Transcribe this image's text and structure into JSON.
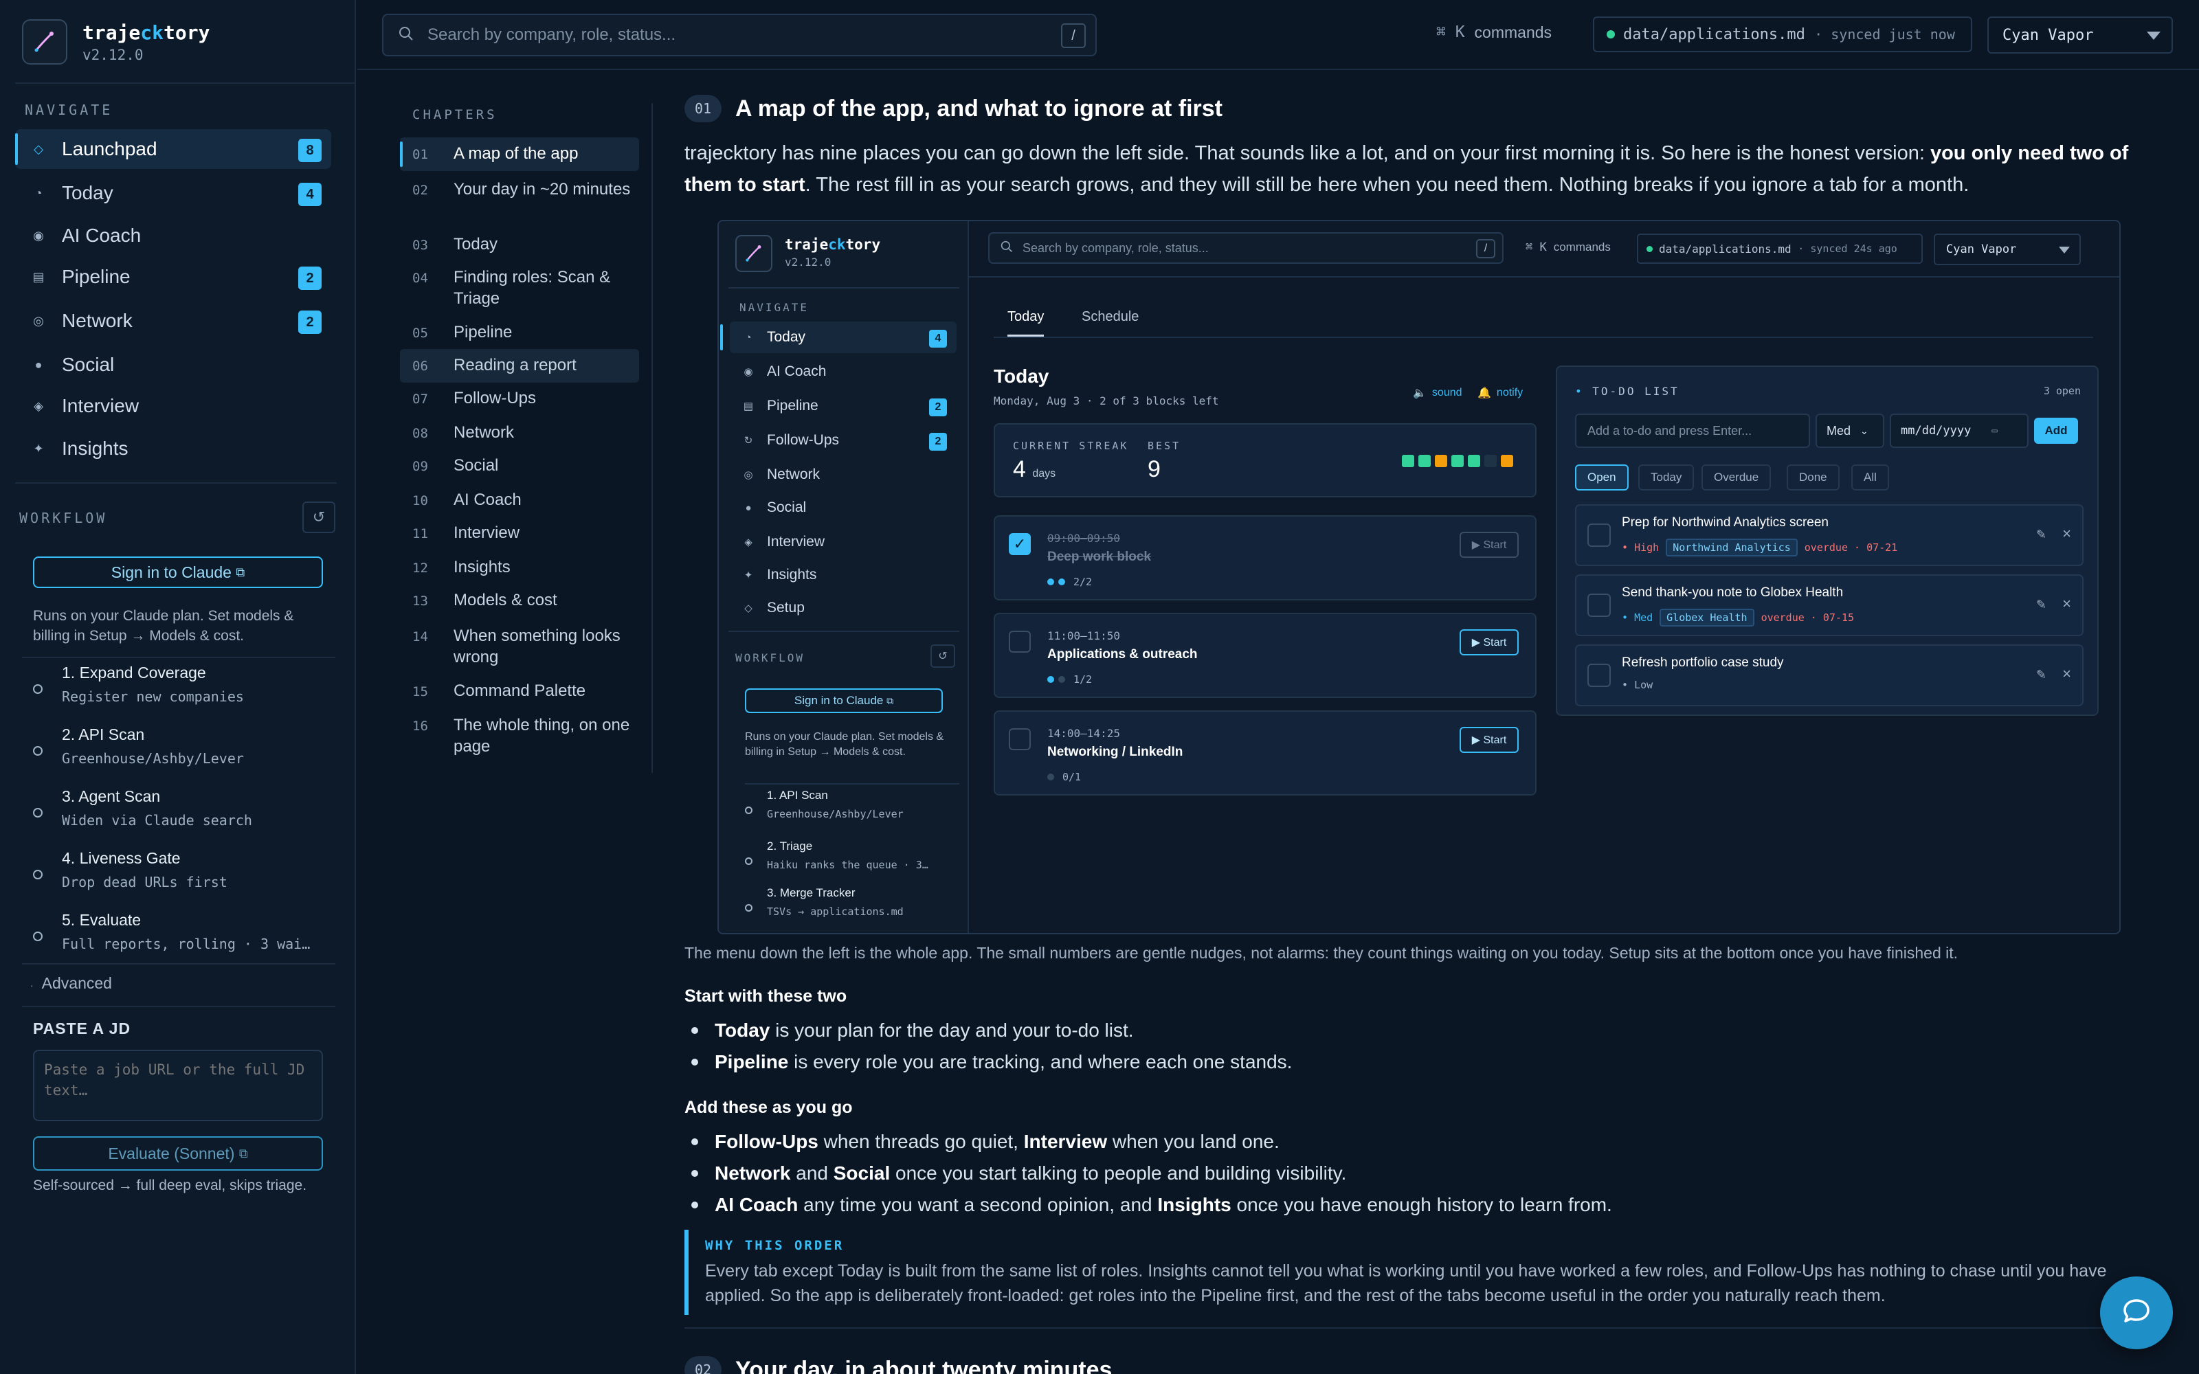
{
  "app": {
    "name_prefix": "traje",
    "name_highlight": "ck",
    "name_suffix": "tory",
    "version": "v2.12.0"
  },
  "sidebar": {
    "navigate_label": "NAVIGATE",
    "items": [
      {
        "label": "Launchpad",
        "icon": "diamond-icon",
        "badge": "8"
      },
      {
        "label": "Today",
        "icon": "half-circle-icon",
        "badge": "4"
      },
      {
        "label": "AI Coach",
        "icon": "target-icon",
        "badge": ""
      },
      {
        "label": "Pipeline",
        "icon": "list-icon",
        "badge": "2"
      },
      {
        "label": "Network",
        "icon": "ring-icon",
        "badge": "2"
      },
      {
        "label": "Social",
        "icon": "dot-icon",
        "badge": ""
      },
      {
        "label": "Interview",
        "icon": "diamond-filled-icon",
        "badge": ""
      },
      {
        "label": "Insights",
        "icon": "sparkle-icon",
        "badge": ""
      }
    ],
    "workflow_label": "WORKFLOW",
    "signin_label": "Sign in to Claude",
    "plan_note": "Runs on your Claude plan. Set models & billing in Setup → Models & cost.",
    "workflow_steps": [
      {
        "title": "1. Expand Coverage",
        "sub": "Register new companies"
      },
      {
        "title": "2. API Scan",
        "sub": "Greenhouse/Ashby/Lever"
      },
      {
        "title": "3. Agent Scan",
        "sub": "Widen via Claude search"
      },
      {
        "title": "4. Liveness Gate",
        "sub": "Drop dead URLs first"
      },
      {
        "title": "5. Evaluate",
        "sub": "Full reports, rolling · 3 wai…"
      }
    ],
    "advanced_label": "Advanced",
    "paste_label": "PASTE A JD",
    "paste_placeholder": "Paste a job URL or the full JD text…",
    "evaluate_label": "Evaluate (Sonnet)",
    "evaluate_note": "Self-sourced → full deep eval, skips triage."
  },
  "topbar": {
    "search_placeholder": "Search by company, role, status...",
    "search_shortcut": "/",
    "commands_key": "⌘ K",
    "commands_label": "commands",
    "sync_file": "data/applications.md",
    "sync_status": "· synced just now",
    "theme": "Cyan Vapor"
  },
  "chapters": {
    "label": "CHAPTERS",
    "items": [
      {
        "num": "01",
        "title": "A map of the app"
      },
      {
        "num": "02",
        "title": "Your day in ~20 minutes"
      },
      {
        "num": "03",
        "title": "Today"
      },
      {
        "num": "04",
        "title": "Finding roles: Scan & Triage"
      },
      {
        "num": "05",
        "title": "Pipeline"
      },
      {
        "num": "06",
        "title": "Reading a report"
      },
      {
        "num": "07",
        "title": "Follow-Ups"
      },
      {
        "num": "08",
        "title": "Network"
      },
      {
        "num": "09",
        "title": "Social"
      },
      {
        "num": "10",
        "title": "AI Coach"
      },
      {
        "num": "11",
        "title": "Interview"
      },
      {
        "num": "12",
        "title": "Insights"
      },
      {
        "num": "13",
        "title": "Models & cost"
      },
      {
        "num": "14",
        "title": "When something looks wrong"
      },
      {
        "num": "15",
        "title": "Command Palette"
      },
      {
        "num": "16",
        "title": "The whole thing, on one page"
      }
    ]
  },
  "section1": {
    "num": "01",
    "title": "A map of the app, and what to ignore at first",
    "intro_before": "trajecktory has nine places you can go down the left side. That sounds like a lot, and on your first morning it is. So here is the honest version: ",
    "intro_bold": "you only need two of them to start",
    "intro_after": ". The rest fill in as your search grows, and they will still be here when you need them. Nothing breaks if you ignore a tab for a month."
  },
  "mini": {
    "navigate_label": "NAVIGATE",
    "nav": [
      {
        "label": "Today",
        "icon": "half-circle-icon",
        "badge": "4"
      },
      {
        "label": "AI Coach",
        "icon": "target-icon",
        "badge": ""
      },
      {
        "label": "Pipeline",
        "icon": "list-icon",
        "badge": "2"
      },
      {
        "label": "Follow-Ups",
        "icon": "refresh-icon",
        "badge": "2"
      },
      {
        "label": "Network",
        "icon": "ring-icon",
        "badge": ""
      },
      {
        "label": "Social",
        "icon": "dot-icon",
        "badge": ""
      },
      {
        "label": "Interview",
        "icon": "diamond-filled-icon",
        "badge": ""
      },
      {
        "label": "Insights",
        "icon": "sparkle-icon",
        "badge": ""
      },
      {
        "label": "Setup",
        "icon": "diamond-icon",
        "badge": ""
      }
    ],
    "workflow_label": "WORKFLOW",
    "signin_label": "Sign in to Claude",
    "plan_note": "Runs on your Claude plan. Set models & billing in Setup → Models & cost.",
    "workflow_steps": [
      {
        "title": "1. API Scan",
        "sub": "Greenhouse/Ashby/Lever"
      },
      {
        "title": "2. Triage",
        "sub": "Haiku ranks the queue · 3…"
      },
      {
        "title": "3. Merge Tracker",
        "sub": "TSVs → applications.md"
      }
    ],
    "search_placeholder": "Search by company, role, status...",
    "search_shortcut": "/",
    "commands_key": "⌘ K",
    "commands_label": "commands",
    "sync_file": "data/applications.md",
    "sync_status": "· synced 24s ago",
    "theme": "Cyan Vapor",
    "tabs": [
      "Today",
      "Schedule"
    ],
    "day_title": "Today",
    "day_sub": "Monday, Aug 3 · 2 of 3 blocks left",
    "sound_label": "sound",
    "notify_label": "notify",
    "streak_label": "CURRENT STREAK",
    "streak_value": "4",
    "streak_unit": "days",
    "best_label": "BEST",
    "best_value": "9",
    "streak_days": [
      "#34d399",
      "#34d399",
      "#f59e0b",
      "#34d399",
      "#34d399",
      "#1f3347",
      "#f59e0b"
    ],
    "blocks": [
      {
        "time": "09:00–09:50",
        "title": "Deep work block",
        "progress": "2/2",
        "done": 2,
        "total": 2,
        "complete": true,
        "start": "▶ Start"
      },
      {
        "time": "11:00–11:50",
        "title": "Applications & outreach",
        "progress": "1/2",
        "done": 1,
        "total": 2,
        "complete": false,
        "start": "▶ Start"
      },
      {
        "time": "14:00–14:25",
        "title": "Networking / LinkedIn",
        "progress": "0/1",
        "done": 0,
        "total": 1,
        "complete": false,
        "start": "▶ Start"
      }
    ],
    "todo": {
      "label": "TO-DO LIST",
      "open_count": "3 open",
      "input_placeholder": "Add a to-do and press Enter...",
      "priority": "Med",
      "date_placeholder": "mm/dd/yyyy",
      "add_label": "Add",
      "filters": [
        "Open",
        "Today",
        "Overdue",
        "Done",
        "All"
      ],
      "items": [
        {
          "title": "Prep for Northwind Analytics screen",
          "priority": "High",
          "company": "Northwind Analytics",
          "due": "overdue · 07-21"
        },
        {
          "title": "Send thank-you note to Globex Health",
          "priority": "Med",
          "company": "Globex Health",
          "due": "overdue · 07-15"
        },
        {
          "title": "Refresh portfolio case study",
          "priority": "Low",
          "company": "",
          "due": ""
        }
      ]
    }
  },
  "caption": "The menu down the left is the whole app. The small numbers are gentle nudges, not alarms: they count things waiting on you today. Setup sits at the bottom once you have finished it.",
  "start_two": {
    "heading": "Start with these two",
    "items": [
      {
        "bold": "Today",
        "text": " is your plan for the day and your to-do list."
      },
      {
        "bold": "Pipeline",
        "text": " is every role you are tracking, and where each one stands."
      }
    ]
  },
  "add_these": {
    "heading": "Add these as you go",
    "line1": {
      "b1": "Follow-Ups",
      "t1": " when threads go quiet, ",
      "b2": "Interview",
      "t2": " when you land one."
    },
    "line2": {
      "b1": "Network",
      "t1": " and ",
      "b2": "Social",
      "t2": " once you start talking to people and building visibility."
    },
    "line3": {
      "b1": "AI Coach",
      "t1": " any time you want a second opinion, and ",
      "b2": "Insights",
      "t2": " once you have enough history to learn from."
    }
  },
  "why": {
    "label": "WHY THIS ORDER",
    "text": "Every tab except Today is built from the same list of roles. Insights cannot tell you what is working until you have worked a few roles, and Follow-Ups has nothing to chase until you have applied. So the app is deliberately front-loaded: get roles into the Pipeline first, and the rest of the tabs become useful in the order you naturally reach them."
  },
  "section2": {
    "num": "02",
    "title": "Your day, in about twenty minutes"
  },
  "colors": {
    "accent": "#38bdf8",
    "bg": "#0b1624",
    "sidebar": "#0d1a29",
    "danger": "#f87171",
    "success": "#34d399",
    "warning": "#f59e0b"
  }
}
